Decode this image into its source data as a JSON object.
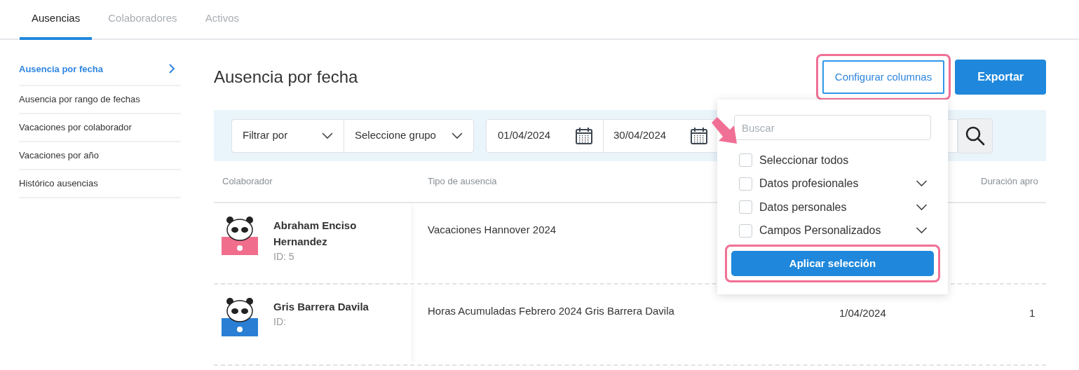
{
  "tabs": [
    {
      "label": "Ausencias",
      "selected": true
    },
    {
      "label": "Colaboradores",
      "selected": false
    },
    {
      "label": "Activos",
      "selected": false
    }
  ],
  "sidebar": {
    "items": [
      {
        "label": "Ausencia por fecha",
        "selected": true
      },
      {
        "label": "Ausencia por rango de fechas",
        "selected": false
      },
      {
        "label": "Vacaciones por colaborador",
        "selected": false
      },
      {
        "label": "Vacaciones por año",
        "selected": false
      },
      {
        "label": "Histórico ausencias",
        "selected": false
      }
    ]
  },
  "page_title": "Ausencia por fecha",
  "buttons": [
    {
      "label": "Configurar columnas",
      "kind": "outline",
      "highlighted": true
    },
    {
      "label": "Exportar",
      "kind": "primary",
      "highlighted": false
    }
  ],
  "filters": {
    "filter_by": "Filtrar por",
    "group": "Seleccione grupo",
    "date_from": "01/04/2024",
    "date_to": "30/04/2024"
  },
  "table": {
    "columns": [
      "Colaborador",
      "Tipo de ausencia",
      "Duración apro"
    ],
    "rows": [
      {
        "name": "Abraham Enciso Hernandez",
        "id": "ID: 5",
        "color": "#f06e8c",
        "type": "Vacaciones Hannover 2024"
      },
      {
        "name": "Gris Barrera Davila",
        "id": "ID:",
        "color": "#2a7fd4",
        "type": "Horas Acumuladas Febrero 2024 Gris Barrera Davila",
        "column_3": "1/04/2024",
        "column_4": "1"
      }
    ]
  },
  "column_menu": {
    "search": {
      "placeholder": "Buscar"
    },
    "options": [
      {
        "label": "Seleccionar todos",
        "checked": false,
        "kind": "all"
      },
      {
        "label": "Datos profesionales",
        "checked": false,
        "kind": "group"
      },
      {
        "label": "Datos personales",
        "checked": false,
        "kind": "group"
      },
      {
        "label": "Campos Personalizados",
        "checked": false,
        "kind": "group"
      }
    ],
    "apply_button": {
      "label": "Aplicar selección",
      "highlighted": true
    }
  }
}
